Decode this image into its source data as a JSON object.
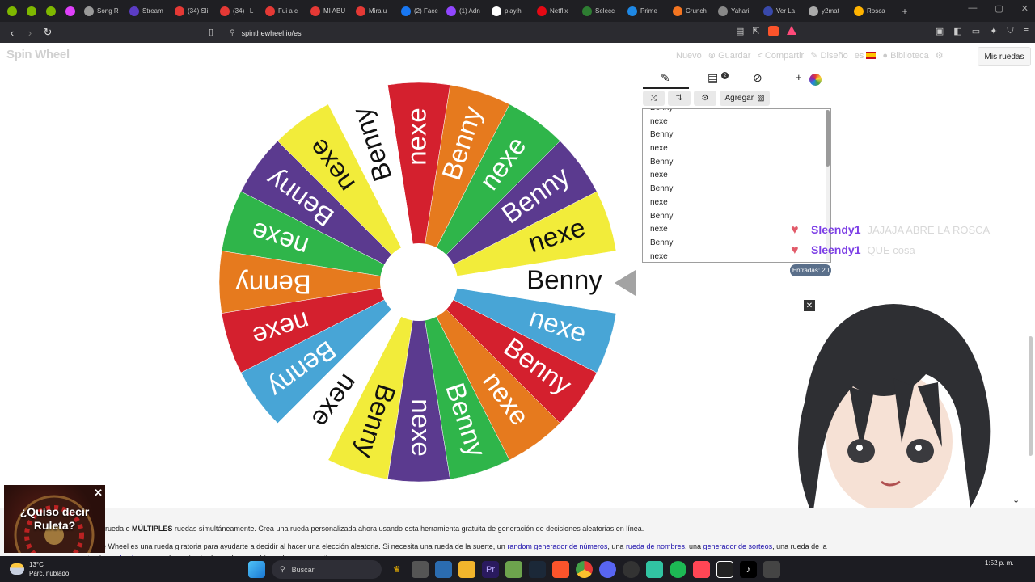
{
  "browser": {
    "tabs": [
      {
        "label": "",
        "color": "#7fb800"
      },
      {
        "label": "",
        "color": "#7fb800"
      },
      {
        "label": "",
        "color": "#7fb800"
      },
      {
        "label": "",
        "color": "#e040fb"
      },
      {
        "label": "Song R",
        "color": "#999"
      },
      {
        "label": "Stream",
        "color": "#5b3cc4"
      },
      {
        "label": "(34) Sli",
        "color": "#e53935"
      },
      {
        "label": "(34) I L",
        "color": "#e53935"
      },
      {
        "label": "Fui a c",
        "color": "#e53935"
      },
      {
        "label": "MI ABU",
        "color": "#e53935"
      },
      {
        "label": "Mira u",
        "color": "#e53935"
      },
      {
        "label": "(2) Face",
        "color": "#1877f2"
      },
      {
        "label": "(1) Adn",
        "color": "#9146ff"
      },
      {
        "label": "play.hl",
        "color": "#fff"
      },
      {
        "label": "Netflix",
        "color": "#e50914"
      },
      {
        "label": "Selecc",
        "color": "#2e7d32"
      },
      {
        "label": "Prime",
        "color": "#1e88e5"
      },
      {
        "label": "Crunch",
        "color": "#f47521"
      },
      {
        "label": "Yahari",
        "color": "#888"
      },
      {
        "label": "Ver La",
        "color": "#3949ab"
      },
      {
        "label": "y2mat",
        "color": "#aaa"
      },
      {
        "label": "Rosca",
        "color": "#ffb300"
      }
    ],
    "new_tab": "+",
    "url": "spinthewheel.io/es"
  },
  "site": {
    "logo": "Spin Wheel",
    "menu": [
      "Nuevo",
      "Guardar",
      "Compartir",
      "Diseño",
      "es"
    ],
    "library": "Biblioteca",
    "my_wheels": "Mis ruedas"
  },
  "wheel": {
    "segments": [
      {
        "label": "Benny",
        "color": "#ffffff"
      },
      {
        "label": "nexe",
        "color": "#f2ec3a"
      },
      {
        "label": "Benny",
        "color": "#5b3a8f"
      },
      {
        "label": "nexe",
        "color": "#2fb54a"
      },
      {
        "label": "Benny",
        "color": "#e67a1e"
      },
      {
        "label": "nexe",
        "color": "#d4202e"
      },
      {
        "label": "Benny",
        "color": "#ffffff"
      },
      {
        "label": "nexe",
        "color": "#f2ec3a"
      },
      {
        "label": "Benny",
        "color": "#5b3a8f"
      },
      {
        "label": "nexe",
        "color": "#2fb54a"
      },
      {
        "label": "Benny",
        "color": "#e67a1e"
      },
      {
        "label": "nexe",
        "color": "#d4202e"
      },
      {
        "label": "Benny",
        "color": "#48a5d6"
      },
      {
        "label": "nexe",
        "color": "#ffffff"
      },
      {
        "label": "Benny",
        "color": "#f2ec3a"
      },
      {
        "label": "nexe",
        "color": "#5b3a8f"
      },
      {
        "label": "Benny",
        "color": "#2fb54a"
      },
      {
        "label": "nexe",
        "color": "#e67a1e"
      },
      {
        "label": "Benny",
        "color": "#d4202e"
      },
      {
        "label": "nexe",
        "color": "#48a5d6"
      }
    ]
  },
  "editor": {
    "add_label": "Agregar",
    "badge": "2",
    "entries": [
      "Benny",
      "nexe",
      "Benny",
      "nexe",
      "Benny",
      "nexe",
      "Benny",
      "nexe",
      "Benny",
      "nexe",
      "Benny",
      "nexe"
    ],
    "count_label": "Entradas: 20"
  },
  "chat": [
    {
      "user": "Sleendy1",
      "message": "JAJAJA ABRE LA ROSCA"
    },
    {
      "user": "Sleendy1",
      "message": "QUE cosa"
    }
  ],
  "description": {
    "line1_a": "rueda o ",
    "line1_bold": "MÚLTIPLES",
    "line1_b": " ruedas simultáneamente. Crea una rueda personalizada ahora usando esta herramienta gratuita de generación de decisiones aleatorias en línea.",
    "line2_a": "e Wheel es una rueda giratoria para ayudarte a decidir al hacer una elección aleatoria. Si necesita una rueda de la suerte, un ",
    "link1": "random generador de números",
    "line2_b": ", una ",
    "link2": "rueda de nombres",
    "line2_c": ", una ",
    "link3": "generador de sorteos",
    "line2_d": ", una rueda de la",
    "line3_a": "simple ",
    "link4": "rueda sí o no",
    "line3_b": ", simplemente gira la rueda para obtener lo que necesitas."
  },
  "ad": {
    "text": "¿Quiso decir Ruleta?"
  },
  "taskbar": {
    "temp": "13°C",
    "weather": "Parc. nublado",
    "search": "Buscar",
    "time": "1:52 p. m."
  }
}
